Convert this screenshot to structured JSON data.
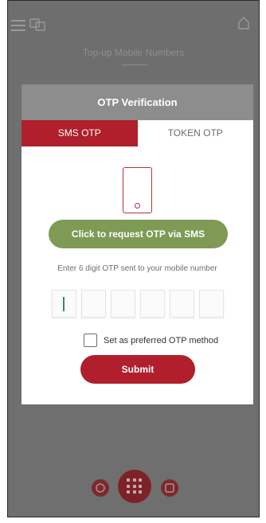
{
  "background": {
    "title": "Top-up Mobile Numbers"
  },
  "modal": {
    "title": "OTP Verification",
    "tabs": [
      {
        "label": "SMS OTP",
        "active": true
      },
      {
        "label": "TOKEN OTP",
        "active": false
      }
    ],
    "request_button": "Click to request OTP via SMS",
    "hint": "Enter 6 digit OTP sent to your mobile number",
    "otp_digits": [
      "",
      "",
      "",
      "",
      "",
      ""
    ],
    "preferred_label": "Set as preferred OTP method",
    "preferred_checked": false,
    "submit_label": "Submit"
  },
  "icons": {
    "menu": "menu-icon",
    "language": "language-icon",
    "home": "home-icon",
    "phone": "phone-icon",
    "nav_left": "cart-icon",
    "nav_center": "grid-menu-icon",
    "nav_right": "card-icon"
  },
  "colors": {
    "brand_red": "#b01f2b",
    "button_green": "#7e9a55",
    "header_gray": "#8d8d8d"
  }
}
